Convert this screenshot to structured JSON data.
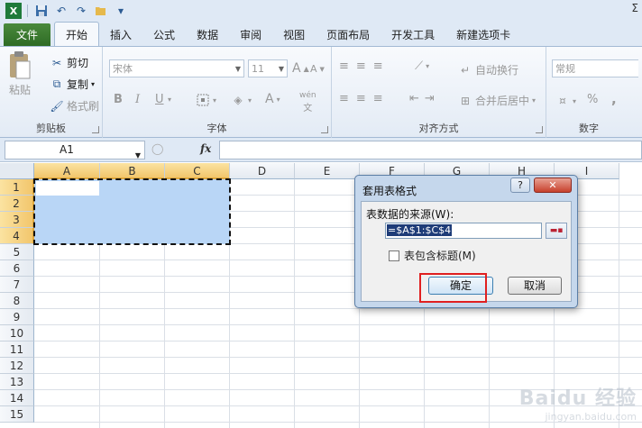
{
  "qat": {
    "icons": [
      "excel-icon",
      "save-icon",
      "undo-icon",
      "redo-icon",
      "open-icon"
    ],
    "right_glyph": "Σ"
  },
  "tabs": [
    {
      "label": "文件",
      "id": "file"
    },
    {
      "label": "开始",
      "id": "home"
    },
    {
      "label": "插入",
      "id": "insert"
    },
    {
      "label": "公式",
      "id": "formulas"
    },
    {
      "label": "数据",
      "id": "data"
    },
    {
      "label": "审阅",
      "id": "review"
    },
    {
      "label": "视图",
      "id": "view"
    },
    {
      "label": "页面布局",
      "id": "page-layout"
    },
    {
      "label": "开发工具",
      "id": "developer"
    },
    {
      "label": "新建选项卡",
      "id": "new-tab"
    }
  ],
  "ribbon": {
    "clipboard": {
      "label": "剪贴板",
      "paste": "粘贴",
      "cut": "剪切",
      "copy": "复制",
      "format_painter": "格式刷"
    },
    "font": {
      "label": "字体",
      "font_name": "宋体",
      "font_size": "11",
      "grow": "A",
      "shrink": "A",
      "bold": "B",
      "italic": "I",
      "underline": "U",
      "font_color": "A",
      "phonetic": "wén"
    },
    "alignment": {
      "label": "对齐方式",
      "wrap": "自动换行",
      "merge": "合并后居中"
    },
    "number": {
      "label": "数字",
      "format": "常规",
      "percent": "%",
      "comma": ","
    }
  },
  "formula_bar": {
    "name_box": "A1",
    "fx": "fx",
    "value": ""
  },
  "grid": {
    "columns": [
      "A",
      "B",
      "C",
      "D",
      "E",
      "F",
      "G",
      "H",
      "I"
    ],
    "rows": [
      "1",
      "2",
      "3",
      "4",
      "5",
      "6",
      "7",
      "8",
      "9",
      "10",
      "11",
      "12",
      "13",
      "14",
      "15"
    ],
    "selected_columns": [
      "A",
      "B",
      "C"
    ],
    "selected_rows": [
      "1",
      "2",
      "3",
      "4"
    ]
  },
  "dialog": {
    "title": "套用表格式",
    "help": "?",
    "close": "✕",
    "source_label": "表数据的来源(W):",
    "source_value": "=$A$1:$C$4",
    "has_headers_label": "表包含标题(M)",
    "has_headers_checked": false,
    "ok": "确定",
    "cancel": "取消"
  },
  "watermark": {
    "brand": "Baidu 经验",
    "url": "jingyan.baidu.com"
  }
}
